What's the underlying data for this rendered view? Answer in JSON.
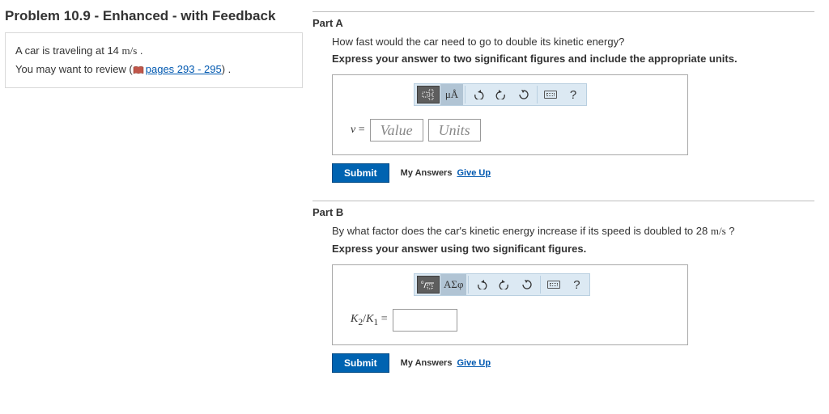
{
  "title": "Problem 10.9 - Enhanced - with Feedback",
  "problem": {
    "line1_pre": "A car is traveling at 14 ",
    "line1_unit": "m/s",
    "line1_post": " .",
    "line2_pre": "You may want to review (",
    "link": "pages 293 - 295",
    "line2_post": ") ."
  },
  "partA": {
    "header": "Part A",
    "question": "How fast would the car need to go to double its kinetic energy?",
    "instruct": "Express your answer to two significant figures and include the appropriate units.",
    "label_var": "v",
    "label_eq": " = ",
    "value_ph": "Value",
    "units_ph": "Units",
    "toolbar": {
      "templates": "⬚⬚",
      "units": "μÅ",
      "help": "?"
    },
    "submit": "Submit",
    "my_answers": "My Answers",
    "give_up": "Give Up"
  },
  "partB": {
    "header": "Part B",
    "q_pre": "By what factor does the car's kinetic energy increase if its speed is doubled to 28 ",
    "q_unit": "m/s",
    "q_post": " ?",
    "instruct": "Express your answer using two significant figures.",
    "label": "K₂/K₁ = ",
    "toolbar": {
      "templates": "⁰√▯",
      "greek": "ΑΣφ",
      "help": "?"
    },
    "submit": "Submit",
    "my_answers": "My Answers",
    "give_up": "Give Up"
  }
}
